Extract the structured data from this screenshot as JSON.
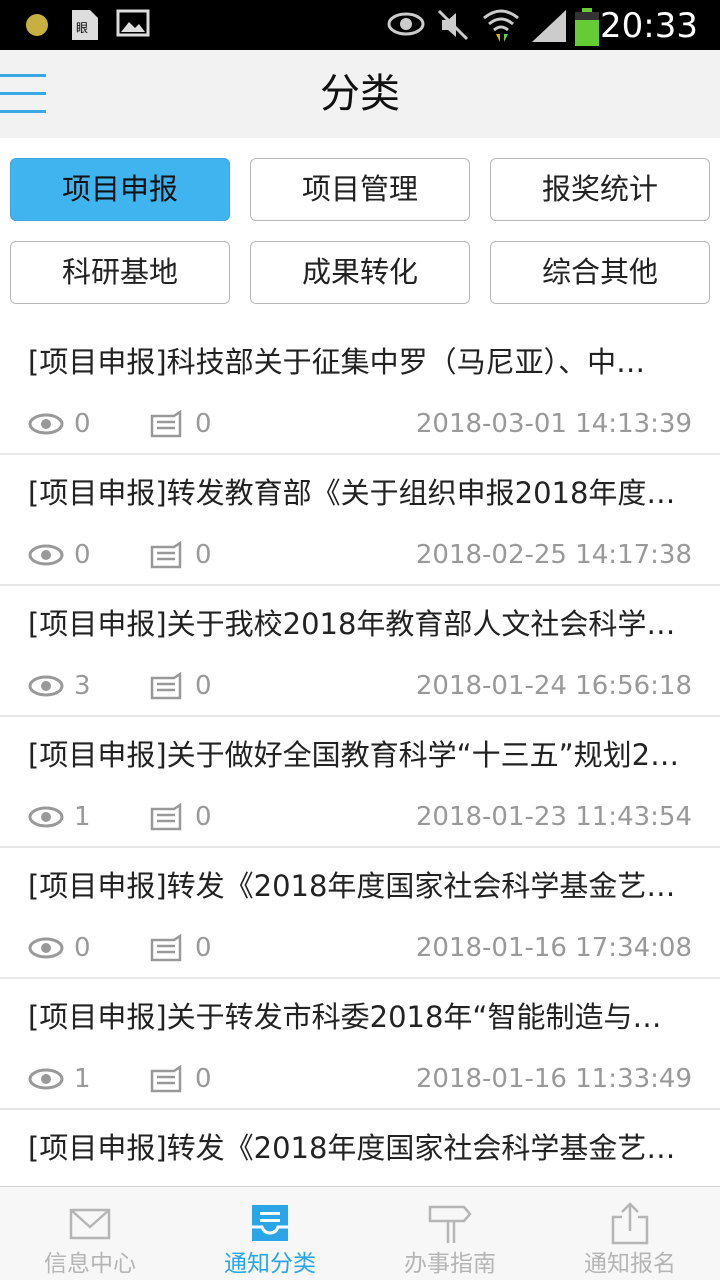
{
  "status_bar": {
    "time": "20:33",
    "icons": [
      "notification-dot-icon",
      "sim-card-icon",
      "image-icon",
      "eye-icon",
      "mute-icon",
      "wifi-icon",
      "signal-icon",
      "battery-icon"
    ]
  },
  "header": {
    "title": "分类",
    "menu_icon": "hamburger-menu-icon"
  },
  "categories": [
    {
      "label": "项目申报",
      "active": true
    },
    {
      "label": "项目管理",
      "active": false
    },
    {
      "label": "报奖统计",
      "active": false
    },
    {
      "label": "科研基地",
      "active": false
    },
    {
      "label": "成果转化",
      "active": false
    },
    {
      "label": "综合其他",
      "active": false
    }
  ],
  "colors": {
    "accent": "#3fb4ee",
    "tab_active": "#2aa5e8",
    "muted_text": "#999999"
  },
  "notices": [
    {
      "title": "[项目申报]科技部关于征集中罗（马尼亚）、中…",
      "views": "0",
      "comments": "0",
      "date": "2018-03-01 14:13:39"
    },
    {
      "title": "[项目申报]转发教育部《关于组织申报2018年度…",
      "views": "0",
      "comments": "0",
      "date": "2018-02-25 14:17:38"
    },
    {
      "title": "[项目申报]关于我校2018年教育部人文社会科学…",
      "views": "3",
      "comments": "0",
      "date": "2018-01-24 16:56:18"
    },
    {
      "title": "[项目申报]关于做好全国教育科学“十三五”规划2…",
      "views": "1",
      "comments": "0",
      "date": "2018-01-23 11:43:54"
    },
    {
      "title": "[项目申报]转发《2018年度国家社会科学基金艺…",
      "views": "0",
      "comments": "0",
      "date": "2018-01-16 17:34:08"
    },
    {
      "title": "[项目申报]关于转发市科委2018年“智能制造与机…",
      "views": "1",
      "comments": "0",
      "date": "2018-01-16 11:33:49"
    },
    {
      "title": "[项目申报]转发《2018年度国家社会科学基金艺…",
      "views": "",
      "comments": "",
      "date": ""
    }
  ],
  "tabs": [
    {
      "label": "信息中心",
      "icon": "envelope-icon",
      "active": false
    },
    {
      "label": "通知分类",
      "icon": "inbox-tray-icon",
      "active": true
    },
    {
      "label": "办事指南",
      "icon": "signpost-icon",
      "active": false
    },
    {
      "label": "通知报名",
      "icon": "upload-share-icon",
      "active": false
    }
  ]
}
